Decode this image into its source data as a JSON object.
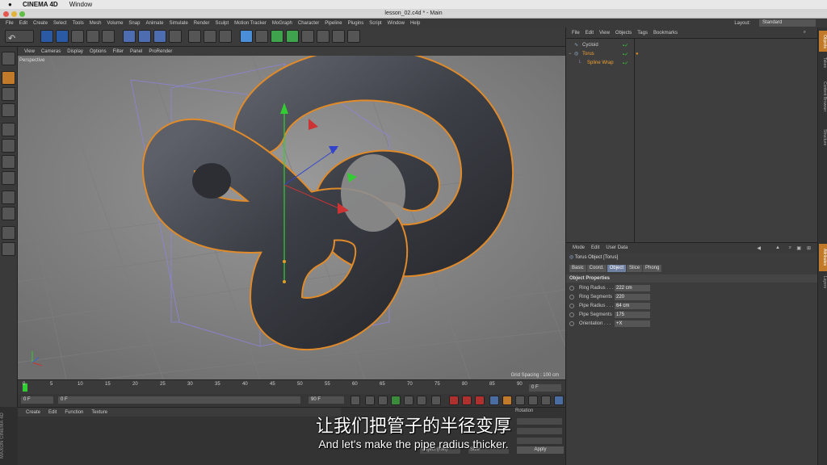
{
  "mac_menu": {
    "app": "CINEMA 4D",
    "window": "Window"
  },
  "window_title": "lesson_02.c4d * - Main",
  "main_menu": [
    "File",
    "Edit",
    "Create",
    "Select",
    "Tools",
    "Mesh",
    "Volume",
    "Snap",
    "Animate",
    "Simulate",
    "Render",
    "Sculpt",
    "Motion Tracker",
    "MoGraph",
    "Character",
    "Pipeline",
    "Plugins",
    "Script",
    "Window",
    "Help"
  ],
  "layout": {
    "label": "Layout:",
    "value": "Standard"
  },
  "viewport": {
    "menu": [
      "View",
      "Cameras",
      "Display",
      "Options",
      "Filter",
      "Panel",
      "ProRender"
    ],
    "camera": "Perspective",
    "grid_spacing": "Grid Spacing : 100 cm"
  },
  "timeline": {
    "ticks": [
      "0",
      "5",
      "10",
      "15",
      "20",
      "25",
      "30",
      "35",
      "40",
      "45",
      "50",
      "55",
      "60",
      "65",
      "70",
      "75",
      "80",
      "85",
      "90"
    ],
    "current_frame": "0 F",
    "start": "0 F",
    "start_field": "0 F",
    "end_field": "90 F",
    "end": "90 F"
  },
  "material_menu": [
    "Create",
    "Edit",
    "Function",
    "Texture"
  ],
  "maxon_label": "MAXON CINEMA 4D",
  "object_manager": {
    "menu": [
      "File",
      "Edit",
      "View",
      "Objects",
      "Tags",
      "Bookmarks"
    ],
    "objects": [
      {
        "name": "Cycloid"
      },
      {
        "name": "Torus"
      },
      {
        "name": "Spline Wrap"
      }
    ]
  },
  "side_tabs": [
    "Objects",
    "Takes",
    "Content Browser",
    "Structure"
  ],
  "side_tabs_lower": [
    "Attributes",
    "Layers"
  ],
  "attributes": {
    "menu": [
      "Mode",
      "Edit",
      "User Data"
    ],
    "object_title": "Torus Object [Torus]",
    "tabs": [
      "Basic",
      "Coord.",
      "Object",
      "Slice",
      "Phong"
    ],
    "active_tab": "Object",
    "section": "Object Properties",
    "properties": [
      {
        "label": "Ring Radius . . .",
        "value": "222 cm"
      },
      {
        "label": "Ring Segments",
        "value": "220"
      },
      {
        "label": "Pipe Radius . . .",
        "value": "64 cm"
      },
      {
        "label": "Pipe Segments",
        "value": "175"
      },
      {
        "label": "Orientation . . .",
        "value": "+X"
      }
    ]
  },
  "coord_panel": {
    "label": "Rotation",
    "mode": "Object (Rel)",
    "size": "Size",
    "apply": "Apply"
  },
  "subtitles": {
    "zh": "让我们把管子的半径变厚",
    "en": "And let's make the pipe radius thicker."
  }
}
